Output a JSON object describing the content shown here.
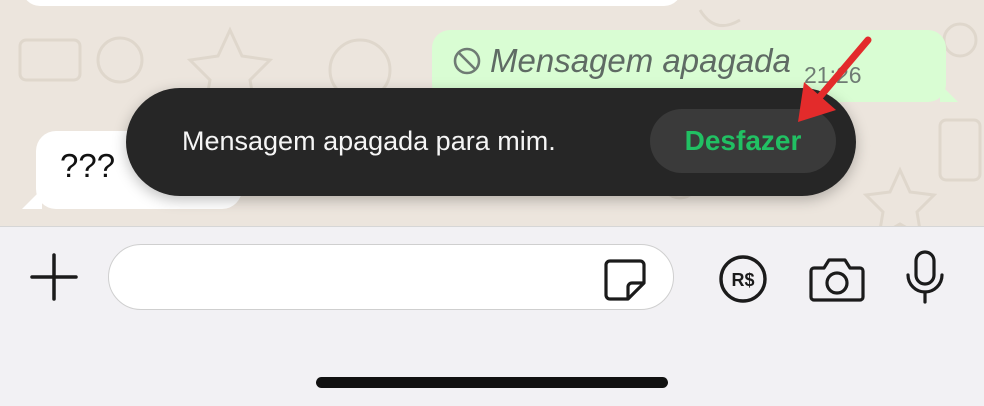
{
  "chat": {
    "deleted_message": {
      "text": "Mensagem apagada",
      "time": "21:26",
      "icon": "prohibited-icon"
    },
    "incoming_message": {
      "text": "???"
    }
  },
  "toast": {
    "message": "Mensagem apagada para mim.",
    "action_label": "Desfazer"
  },
  "composer": {
    "placeholder": "",
    "value": "",
    "icons": [
      "plus-icon",
      "sticker-icon",
      "payment-icon",
      "camera-icon",
      "microphone-icon"
    ],
    "payment_icon_label": "R$"
  },
  "colors": {
    "outgoing_bubble": "#d9fdd3",
    "incoming_bubble": "#ffffff",
    "chat_background": "#ece5dd",
    "toast_background": "#262626",
    "action_green": "#21c063",
    "annotation_arrow": "#e32b2b"
  }
}
